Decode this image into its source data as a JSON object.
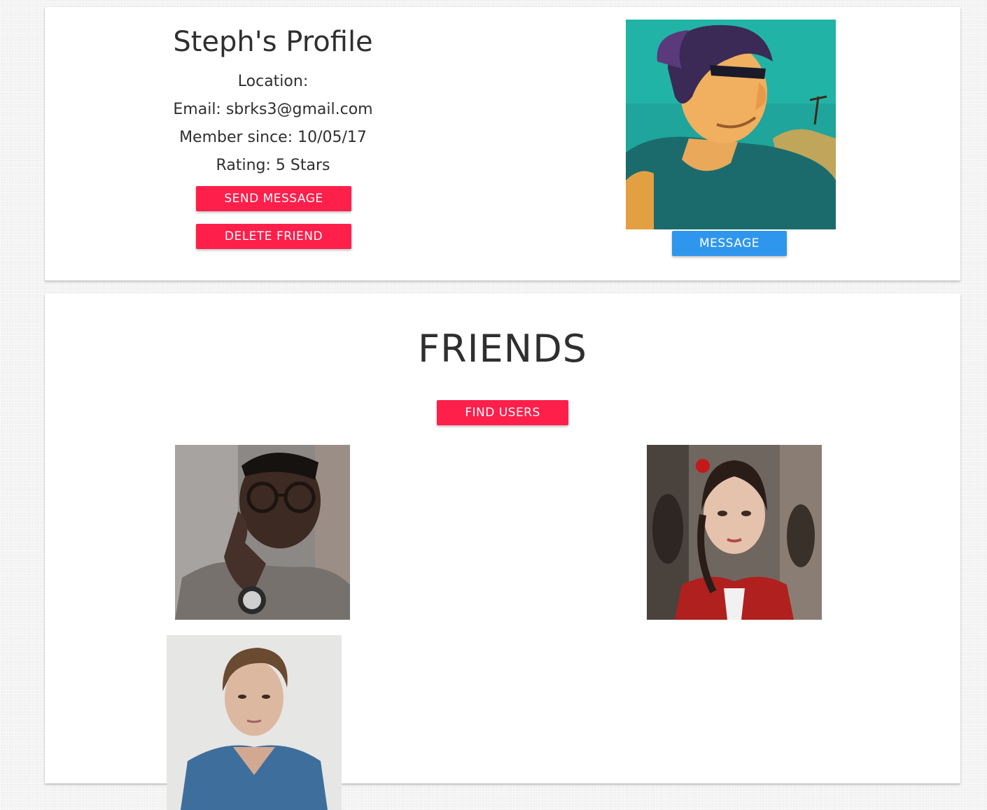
{
  "profile": {
    "title": "Steph's Profile",
    "location": "Location:",
    "email": "Email: sbrks3@gmail.com",
    "member_since": "Member since: 10/05/17",
    "rating": "Rating: 5 Stars",
    "send_message_label": "SEND MESSAGE",
    "delete_friend_label": "DELETE FRIEND",
    "message_label": "MESSAGE"
  },
  "friends": {
    "title": "FRIENDS",
    "find_users_label": "FIND USERS",
    "photo_count": 3
  },
  "colors": {
    "primary_button": "#ff1f4b",
    "secondary_button": "#2f96ee",
    "text": "#2f2f2f",
    "card": "#ffffff"
  }
}
